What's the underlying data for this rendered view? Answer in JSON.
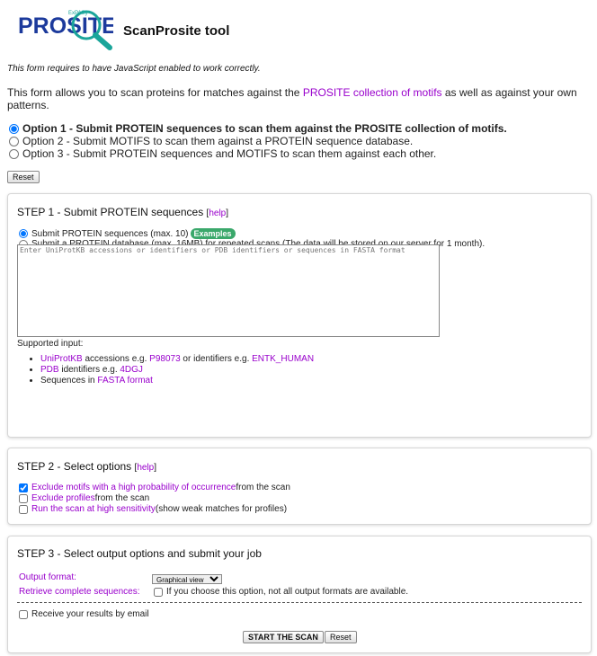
{
  "header": {
    "logo_text": "PROSITE",
    "logo_subtext": "ExPASy",
    "title": "ScanProsite tool"
  },
  "js_note": "This form requires to have JavaScript enabled to work correctly.",
  "intro": {
    "text_before": "This form allows you to scan proteins for matches against the ",
    "link": "PROSITE collection of motifs",
    "text_after": " as well as against your own patterns."
  },
  "options": [
    {
      "label": "Option 1 - Submit PROTEIN sequences to scan them against the PROSITE collection of motifs.",
      "selected": true
    },
    {
      "label": "Option 2 - Submit MOTIFS to scan them against a PROTEIN sequence database.",
      "selected": false
    },
    {
      "label": "Option 3 - Submit PROTEIN sequences and MOTIFS to scan them against each other.",
      "selected": false
    }
  ],
  "reset_label": "Reset",
  "step1": {
    "title": "STEP 1 - Submit PROTEIN sequences",
    "help": "help",
    "radio1": "Submit PROTEIN sequences (max. 10)",
    "examples": "Examples",
    "radio2": "Submit a PROTEIN database (max. 16MB) for repeated scans (The data will be stored on our server for 1 month).",
    "placeholder": "Enter UniProtKB accessions or identifiers or PDB identifiers or sequences in FASTA format",
    "supported": "Supported input:",
    "items": [
      {
        "link": "UniProtKB",
        "t1": " accessions e.g. ",
        "ex1": "P98073",
        "t2": " or identifiers e.g. ",
        "ex2": "ENTK_HUMAN"
      },
      {
        "link": "PDB",
        "t1": " identifiers e.g. ",
        "ex1": "4DGJ"
      },
      {
        "pre": "Sequences in ",
        "link": "FASTA format"
      }
    ]
  },
  "step2": {
    "title": "STEP 2 - Select options",
    "help": "help",
    "checks": [
      {
        "link": "Exclude motifs with a high probability of occurrence",
        "text": " from the scan",
        "checked": true
      },
      {
        "link": "Exclude profiles",
        "text": " from the scan",
        "checked": false
      },
      {
        "link": "Run the scan at high sensitivity",
        "text": " (show weak matches for profiles)",
        "checked": false
      }
    ]
  },
  "step3": {
    "title": "STEP 3 - Select output options and submit your job",
    "output_format_label": "Output format:",
    "output_format_value": "Graphical view",
    "retrieve_label": "Retrieve complete sequences:",
    "retrieve_note": "If you choose this option, not all output formats are available.",
    "email_label": "Receive your results by email",
    "start_label": "START THE SCAN",
    "reset_label": "Reset"
  },
  "colors": {
    "link": "#9900cc",
    "examples_badge": "#3aa86b",
    "logo_blue": "#1c3a9c",
    "logo_teal": "#1aa59a"
  }
}
